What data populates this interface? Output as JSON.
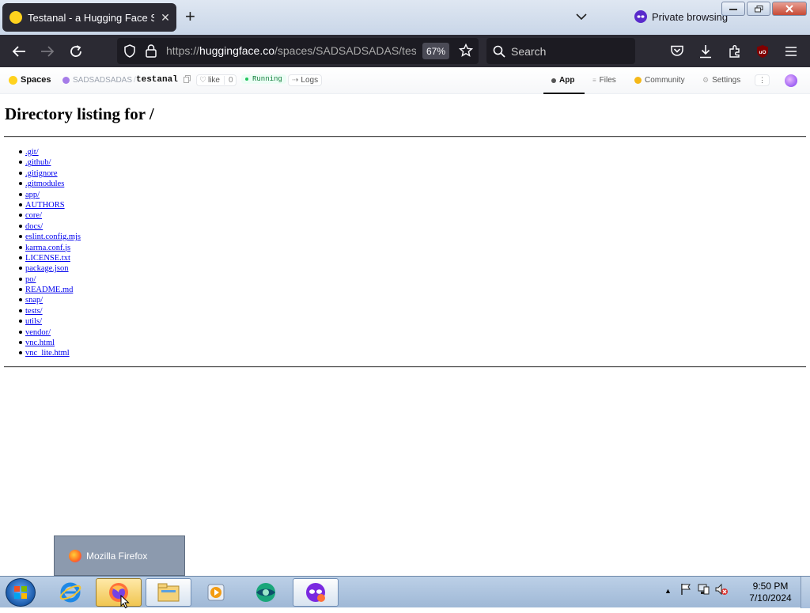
{
  "browser": {
    "tab_title": "Testanal - a Hugging Face Space by SADSADSADAS",
    "tab_close": "✕",
    "new_tab": "+",
    "private_label": "Private browsing",
    "url_prefix": "https://",
    "url_domain": "huggingface.co",
    "url_path": "/spaces/SADSADSADAS/testanal",
    "zoom": "67%",
    "search_placeholder": "Search",
    "ublock_label": "uO"
  },
  "hf": {
    "spaces_label": "Spaces",
    "owner": "SADSADSADAS",
    "separator": "/",
    "repo": "testanal",
    "like_label": "like",
    "like_count": "0",
    "status": "Running",
    "logs_label": "Logs",
    "tabs": [
      {
        "label": "App"
      },
      {
        "label": "Files"
      },
      {
        "label": "Community"
      },
      {
        "label": "Settings"
      }
    ],
    "more_label": "⋮"
  },
  "listing": {
    "heading": "Directory listing for /",
    "files": [
      ".git/",
      ".github/",
      ".gitignore",
      ".gitmodules",
      "app/",
      "AUTHORS",
      "core/",
      "docs/",
      "eslint.config.mjs",
      "karma.conf.js",
      "LICENSE.txt",
      "package.json",
      "po/",
      "README.md",
      "snap/",
      "tests/",
      "utils/",
      "vendor/",
      "vnc.html",
      "vnc_lite.html"
    ]
  },
  "taskbar": {
    "popup_label": "Mozilla Firefox",
    "time": "9:50 PM",
    "date": "7/10/2024"
  },
  "colors": {
    "accent_private": "#592acb",
    "link": "#0000ee",
    "browser_chrome": "#2b2a33"
  }
}
